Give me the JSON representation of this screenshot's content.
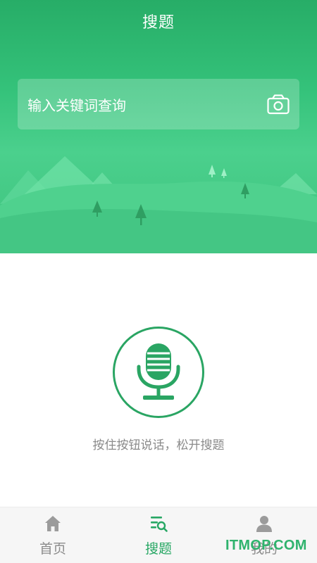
{
  "header": {
    "title": "搜题"
  },
  "search": {
    "placeholder": "输入关键词查询",
    "icon": "camera-icon"
  },
  "voice": {
    "icon": "microphone-icon",
    "hint": "按住按钮说话，松开搜题",
    "accent": "#2aa563"
  },
  "tabs": [
    {
      "label": "首页",
      "icon": "home-icon",
      "active": false
    },
    {
      "label": "搜题",
      "icon": "search-list-icon",
      "active": true
    },
    {
      "label": "我的",
      "icon": "user-icon",
      "active": false
    }
  ],
  "watermark": {
    "text": "ITMOP.COM"
  },
  "colors": {
    "brand_green": "#27ad67",
    "tab_active": "#27a764",
    "tab_inactive": "#8c8c8c"
  }
}
